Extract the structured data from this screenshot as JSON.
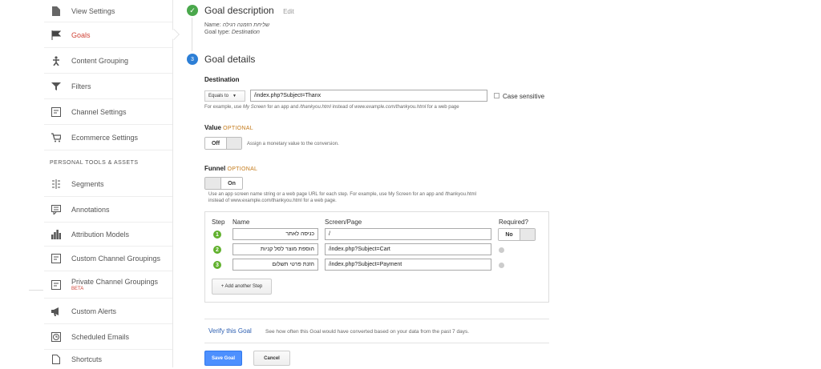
{
  "sidebar": {
    "items": [
      {
        "label": "View Settings",
        "icon": "document-icon"
      },
      {
        "label": "Goals",
        "icon": "flag-icon"
      },
      {
        "label": "Content Grouping",
        "icon": "person-icon"
      },
      {
        "label": "Filters",
        "icon": "filter-icon"
      },
      {
        "label": "Channel Settings",
        "icon": "channel-icon"
      },
      {
        "label": "Ecommerce Settings",
        "icon": "cart-icon"
      }
    ],
    "section_label": "PERSONAL TOOLS & ASSETS",
    "tools": [
      {
        "label": "Segments",
        "icon": "segments-icon"
      },
      {
        "label": "Annotations",
        "icon": "comment-icon"
      },
      {
        "label": "Attribution Models",
        "icon": "bars-icon"
      },
      {
        "label": "Custom Channel Groupings",
        "icon": "channel-icon"
      },
      {
        "label": "Private Channel Groupings",
        "icon": "channel-icon",
        "badge": "BETA"
      },
      {
        "label": "Custom Alerts",
        "icon": "megaphone-icon"
      },
      {
        "label": "Scheduled Emails",
        "icon": "clock-icon"
      },
      {
        "label": "Shortcuts",
        "icon": "document-icon"
      }
    ]
  },
  "goal_description": {
    "title": "Goal description",
    "edit": "Edit",
    "name_label": "Name:",
    "name_value": "שליחת הזמנה רגילה",
    "type_label": "Goal type:",
    "type_value": "Destination"
  },
  "goal_details": {
    "step_number": "3",
    "title": "Goal details",
    "destination": {
      "label": "Destination",
      "match_type": "Equals to",
      "value": "/index.php?Subject=Thanx",
      "case_sensitive": "Case sensitive",
      "hint_prefix": "For example, use",
      "hint_screen": "My Screen",
      "hint_mid": "for an app and",
      "hint_url1": "/thankyou.html",
      "hint_mid2": "instead of",
      "hint_url2": "www.example.com/thankyou.html",
      "hint_suffix": "for a web page"
    },
    "value": {
      "label": "Value",
      "optional": "OPTIONAL",
      "toggle": "Off",
      "description": "Assign a monetary value to the conversion."
    },
    "funnel": {
      "label": "Funnel",
      "optional": "OPTIONAL",
      "toggle": "On",
      "hint_line1": "Use an app screen name string or a web page URL for each step. For example, use My Screen for an app and /thankyou.html",
      "hint_line2": "instead of www.example.com/thankyou.html for a web page.",
      "col_step": "Step",
      "col_name": "Name",
      "col_screen": "Screen/Page",
      "col_required": "Required?",
      "required_toggle": "No",
      "steps": [
        {
          "num": "1",
          "name": "כניסה לאתר",
          "screen": "/"
        },
        {
          "num": "2",
          "name": "הוספת מוצר לסל קניות",
          "screen": "/index.php?Subject=Cart"
        },
        {
          "num": "3",
          "name": "הזנת פרטי תשלום",
          "screen": "/index.php?Subject=Payment"
        }
      ],
      "add_step": "+ Add another Step"
    },
    "verify": {
      "link": "Verify this Goal",
      "text": "See how often this Goal would have converted based on your data from the past 7 days."
    },
    "save": "Save Goal",
    "cancel": "Cancel"
  },
  "colors": {
    "accent": "#d04437",
    "primary": "#4d90fe",
    "success": "#4aa84c",
    "step": "#2d7fd6"
  }
}
